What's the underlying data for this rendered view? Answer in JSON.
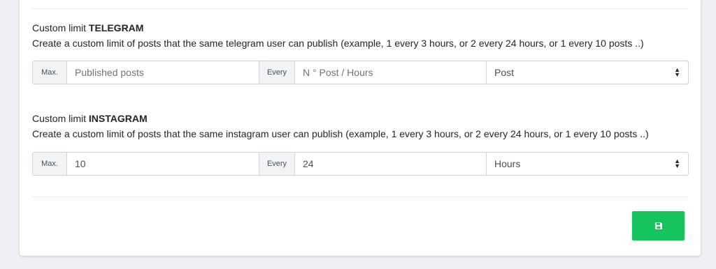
{
  "telegram": {
    "title_prefix": "Custom limit",
    "title_bold": "TELEGRAM",
    "description": "Create a custom limit of posts that the same telegram user can publish (example, 1 every 3 hours, or 2 every 24 hours, or 1 every 10 posts ..)",
    "max_label": "Max.",
    "max_value": "",
    "max_placeholder": "Published posts",
    "every_label": "Every",
    "every_value": "",
    "every_placeholder": "N ° Post / Hours",
    "unit_selected": "Post"
  },
  "instagram": {
    "title_prefix": "Custom limit",
    "title_bold": "INSTAGRAM",
    "description": "Create a custom limit of posts that the same instagram user can publish (example, 1 every 3 hours, or 2 every 24 hours, or 1 every 10 posts ..)",
    "max_label": "Max.",
    "max_value": "10",
    "every_label": "Every",
    "every_value": "24",
    "unit_selected": "Hours"
  },
  "save_button": {
    "icon": "save-icon",
    "color": "#16c45b"
  }
}
